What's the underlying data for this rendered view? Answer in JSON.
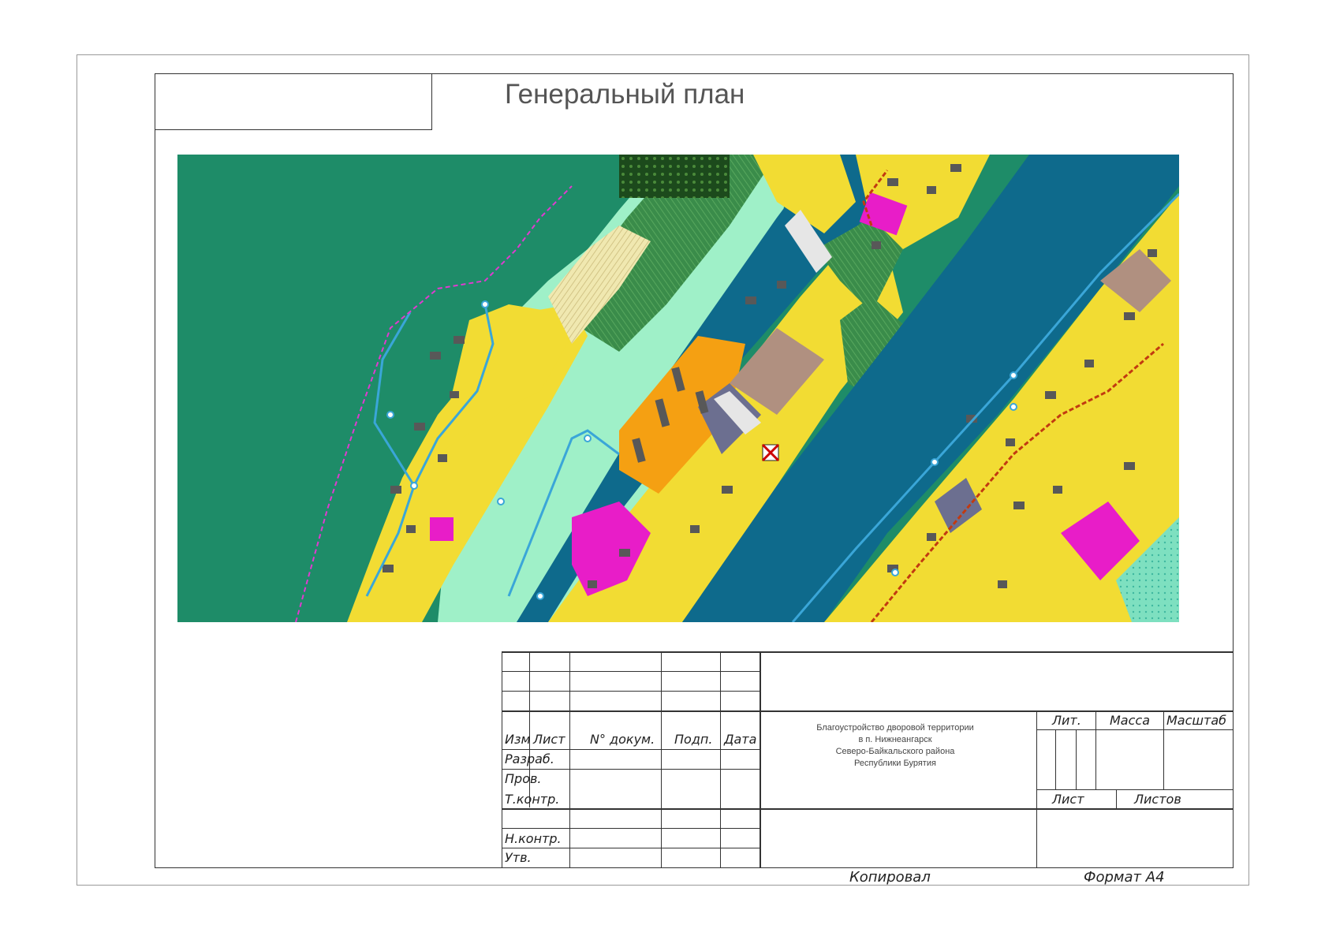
{
  "sheet": {
    "title": "Генеральный план"
  },
  "title_block": {
    "headers": {
      "izm": "Изм",
      "list": "Лист",
      "doc_no": "N° докум.",
      "sign": "Подп.",
      "date": "Дата"
    },
    "roles": {
      "razrab": "Разраб.",
      "prov": "Пров.",
      "tkontr": "Т.контр.",
      "nkontr": "Н.контр.",
      "utv": "Утв."
    },
    "project": {
      "line1": "Благоустройство дворовой территории",
      "line2": "в п. Нижнеангарск",
      "line3": "Северо-Байкальского района",
      "line4": "Республики Бурятия"
    },
    "lit": "Лит.",
    "massa": "Масса",
    "masshtab": "Масштаб",
    "sheet_label": "Лист",
    "sheets_label": "Листов",
    "copied": "Копировал",
    "format": "Формат  А4"
  },
  "map": {
    "colors": {
      "water_lake": "#1e8c68",
      "river": "#0e6a8c",
      "residential": "#f2dc33",
      "building": "#585858",
      "public": "#e81dc8",
      "green_strip": "#3a8c4a",
      "orange_zone": "#f5a012",
      "brown_zone": "#b09080",
      "grey_zone": "#6c6f90",
      "pale_green": "#9ff0c8",
      "road": "#e6e6e6",
      "utility_blue": "#3aa6d8",
      "utility_red": "#c23a10"
    }
  }
}
